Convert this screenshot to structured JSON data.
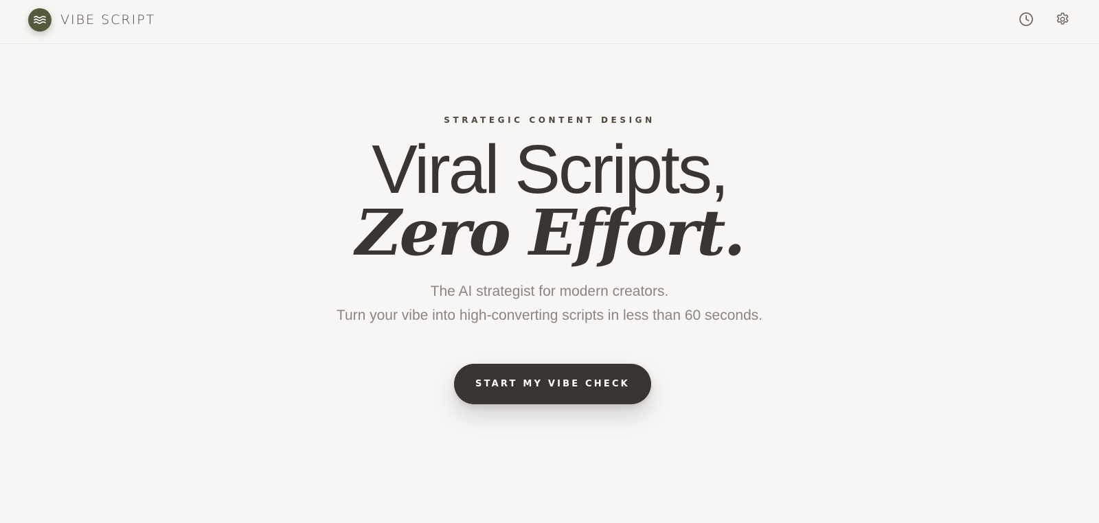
{
  "header": {
    "brand_name": "VIBE SCRIPT",
    "logo_icon": "waves-icon",
    "actions": [
      {
        "icon": "history-clock-icon"
      },
      {
        "icon": "gear-icon"
      }
    ]
  },
  "hero": {
    "eyebrow": "STRATEGIC CONTENT DESIGN",
    "headline_line1": "Viral Scripts,",
    "headline_line2": "Zero Effort.",
    "subtitle_line1": "The AI strategist for modern creators.",
    "subtitle_line2": "Turn your vibe into high-converting scripts in less than 60 seconds.",
    "cta_label": "START MY VIBE CHECK"
  },
  "colors": {
    "background": "#f7f6f4",
    "logo_fill": "#545a3c",
    "text_dark": "#3a3432",
    "text_muted": "#8a8582",
    "eyebrow": "#4c4a38",
    "cta_bg": "#3a3432"
  }
}
